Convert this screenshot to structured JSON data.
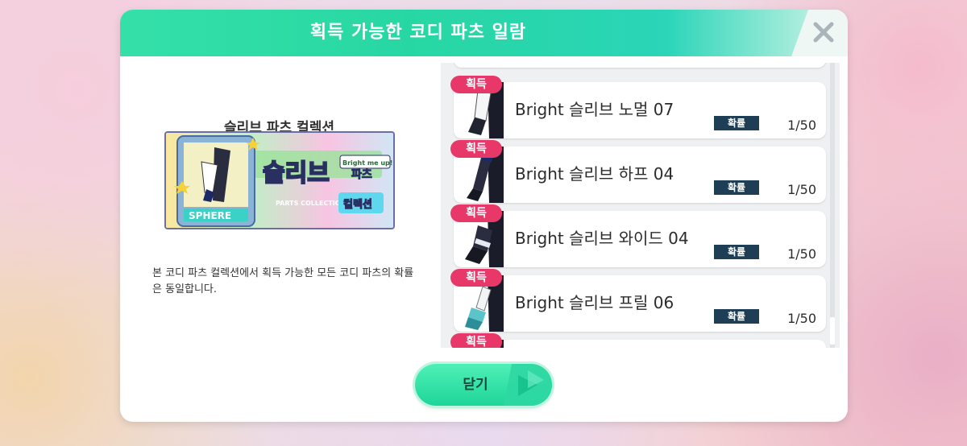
{
  "dialog": {
    "title": "획득 가능한 코디 파츠 일람",
    "close_icon": "close-icon"
  },
  "collection": {
    "name": "슬리브 파츠 컬렉션",
    "image_text": {
      "headline": "슬리브",
      "sub": "파츠",
      "sub2": "컬렉션",
      "caption": "PARTS COLLECTION",
      "brand": "SPHERE",
      "tag": "Bright me up!!"
    },
    "description": "본 코디 파츠 컬렉션에서 획득 가능한 모든 코디 파츠의 확률은 동일합니다."
  },
  "list": {
    "items": [
      {
        "badge": "획득",
        "name": "Bright 슬리브 노멀 07",
        "prob_label": "확률",
        "prob": "1/50",
        "icon": "sleeve-normal-icon"
      },
      {
        "badge": "획득",
        "name": "Bright 슬리브 하프 04",
        "prob_label": "확률",
        "prob": "1/50",
        "icon": "sleeve-half-icon"
      },
      {
        "badge": "획득",
        "name": "Bright 슬리브 와이드 04",
        "prob_label": "확률",
        "prob": "1/50",
        "icon": "sleeve-wide-icon"
      },
      {
        "badge": "획득",
        "name": "Bright 슬리브 프릴 06",
        "prob_label": "확률",
        "prob": "1/50",
        "icon": "sleeve-frill-icon"
      },
      {
        "badge": "획득"
      }
    ]
  },
  "footer": {
    "close_label": "닫기"
  },
  "colors": {
    "accent": "#27d7a3",
    "badge": "#e8386a",
    "prob_label_bg": "#1e3e55"
  }
}
